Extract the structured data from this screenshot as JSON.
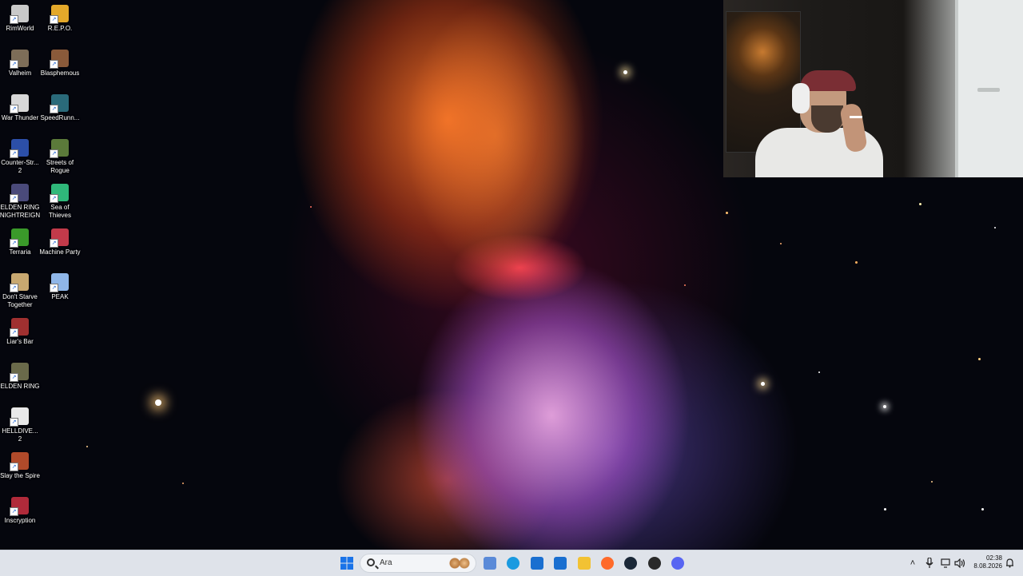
{
  "desktop": {
    "icons": [
      {
        "label": "RimWorld",
        "color": "#c9c9c9"
      },
      {
        "label": "R.E.P.O.",
        "color": "#e3a82a"
      },
      {
        "label": "Valheim",
        "color": "#7d6d58"
      },
      {
        "label": "Blasphemous",
        "color": "#8a5a3a"
      },
      {
        "label": "War Thunder",
        "color": "#d8d8d8"
      },
      {
        "label": "SpeedRunn...",
        "color": "#2a6a7a"
      },
      {
        "label": "Counter-Str... 2",
        "color": "#2c4fa8"
      },
      {
        "label": "Streets of Rogue",
        "color": "#5b7a3a"
      },
      {
        "label": "ELDEN RING NIGHTREIGN",
        "color": "#4a4a7a"
      },
      {
        "label": "Sea of Thieves",
        "color": "#2fb87a"
      },
      {
        "label": "Terraria",
        "color": "#3a9a2a"
      },
      {
        "label": "Machine Party",
        "color": "#c23a4a"
      },
      {
        "label": "Don't Starve Together",
        "color": "#c8a870"
      },
      {
        "label": "PEAK",
        "color": "#8fb6e8"
      },
      {
        "label": "Liar's Bar",
        "color": "#a03030"
      },
      {
        "label": "ELDEN RING",
        "color": "#6a6a4a"
      },
      {
        "label": "HELLDIVE... 2",
        "color": "#e8e8e8"
      },
      {
        "label": "Slay the Spire",
        "color": "#b04a2a"
      },
      {
        "label": "Inscryption",
        "color": "#b02a3a"
      }
    ]
  },
  "taskbar": {
    "search_placeholder": "Ara",
    "pinned": [
      {
        "name": "widgets",
        "color": "#5a8ad8"
      },
      {
        "name": "edge",
        "color": "#1a9ae0"
      },
      {
        "name": "store",
        "color": "#1a6fd0"
      },
      {
        "name": "outlook",
        "color": "#1a6fd0"
      },
      {
        "name": "file-explorer",
        "color": "#f2c233"
      },
      {
        "name": "firefox",
        "color": "#ff6a2a"
      },
      {
        "name": "steam",
        "color": "#1b2838"
      },
      {
        "name": "obs",
        "color": "#2a2a2a"
      },
      {
        "name": "discord",
        "color": "#5865f2"
      }
    ],
    "clock": {
      "time": "02:38",
      "date": "8.08.2026"
    }
  }
}
